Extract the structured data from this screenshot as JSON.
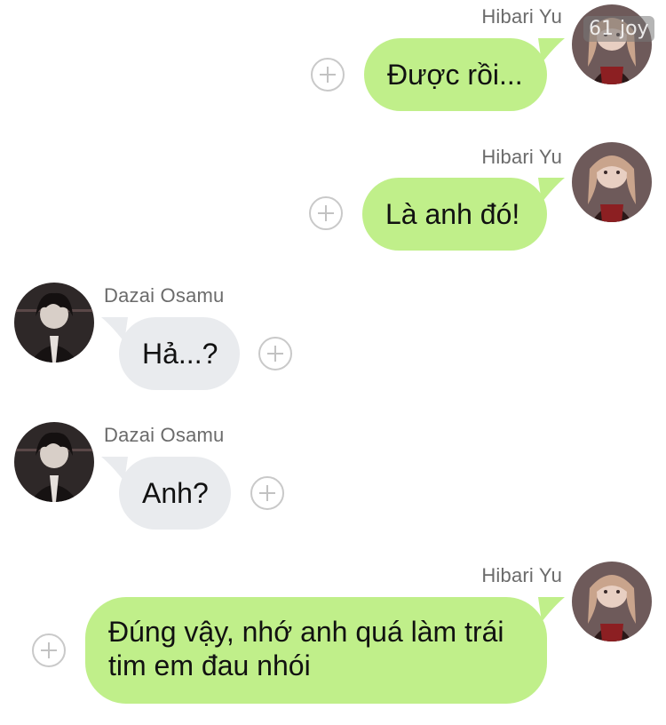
{
  "messages": [
    {
      "sender": "Hibari Yu",
      "text": "Được rồi...",
      "direction": "outgoing"
    },
    {
      "sender": "Hibari Yu",
      "text": "Là anh đó!",
      "direction": "outgoing"
    },
    {
      "sender": "Dazai Osamu",
      "text": "Hả...?",
      "direction": "incoming"
    },
    {
      "sender": "Dazai Osamu",
      "text": "Anh?",
      "direction": "incoming"
    },
    {
      "sender": "Hibari Yu",
      "text": "Đúng vậy, nhớ anh quá làm trái tim em đau nhói",
      "direction": "outgoing"
    }
  ],
  "watermark": "61 joy",
  "colors": {
    "outgoing_bubble": "#c0ef8a",
    "incoming_bubble": "#e9ebee",
    "name_text": "#6b6b6b"
  },
  "icons": {
    "add": "plus-circle-icon",
    "avatar_outgoing": "avatar-hibari-yu",
    "avatar_incoming": "avatar-dazai-osamu"
  }
}
